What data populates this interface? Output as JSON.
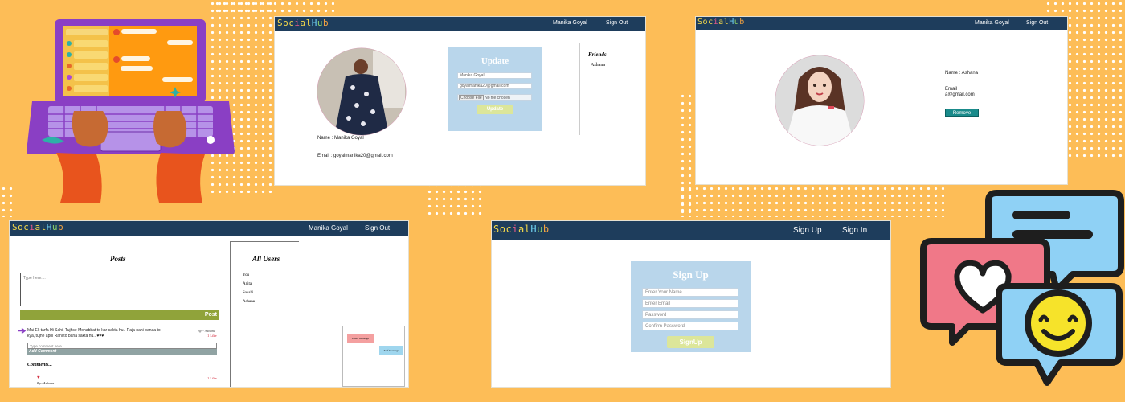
{
  "colors": {
    "background": "#fdbd57",
    "navbar": "#1e3d5c",
    "form_box": "#b9d6eb",
    "button_green": "#dce69a",
    "post_bar": "#90a33a",
    "remove_friend": "#1a8b8b"
  },
  "brand": {
    "letters": [
      "S",
      "o",
      "c",
      "i",
      "a",
      "l",
      "H",
      "u",
      "b"
    ]
  },
  "profile_window": {
    "user_name": "Manika Goyal",
    "sign_out": "Sign Out",
    "update": {
      "title": "Update",
      "name_value": "Manika Goyal",
      "email_value": "goyalmanika20@gmail.com",
      "choose_file": "Choose File",
      "no_file": "No file chosen",
      "button": "Update"
    },
    "friends_title": "Friends",
    "friend": "Ashana",
    "name_line": "Name : Manika Goyal",
    "email_line": "Email : goyalmanika20@gmail.com"
  },
  "friend_window": {
    "user_name": "Manika Goyal",
    "sign_out": "Sign Out",
    "name_line": "Name : Ashana",
    "email_label": "Email :",
    "email_value": "a@gmail.com",
    "remove_button": "Remove Friend"
  },
  "posts_window": {
    "user_name": "Manika Goyal",
    "sign_out": "Sign Out",
    "posts_title": "Posts",
    "textarea_placeholder": "Type here....",
    "post_button": "Post",
    "post_text_1": "Mai Ek tarfa Hi Sahi, Tujhse Mohabbat to kar sakta hu.. Raja nahi banaa to",
    "post_text_2": "kya, tujhe apni Rani to bana sakta hu..",
    "post_author": "By:- Ashana",
    "post_likes": "1 Like",
    "comment_placeholder": "Type comment here...",
    "add_comment": "Add Comment",
    "comments_title": "Comments...",
    "comment_author": "By:-Ashana",
    "comment_likes": "1 Like",
    "all_users_title": "All Users",
    "users": [
      "You",
      "Anita",
      "Sakshi",
      "Ashana"
    ],
    "chat_other": "Other Message",
    "chat_self": "Self Message"
  },
  "signup_window": {
    "sign_up_link": "Sign Up",
    "sign_in_link": "Sign In",
    "title": "Sign Up",
    "name_placeholder": "Enter Your Name",
    "email_placeholder": "Enter Email",
    "password_placeholder": "Password",
    "confirm_placeholder": "Confirm Password",
    "button": "SignUp"
  }
}
